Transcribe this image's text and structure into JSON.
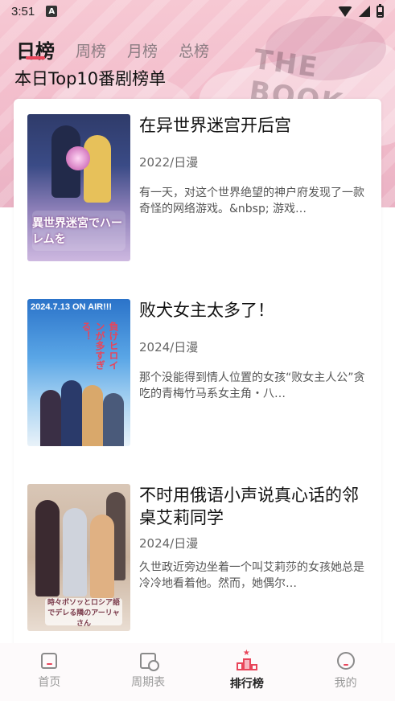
{
  "status_bar": {
    "time": "3:51",
    "notification_glyph": "A"
  },
  "tabs": [
    {
      "label": "日榜",
      "active": true
    },
    {
      "label": "周榜",
      "active": false
    },
    {
      "label": "月榜",
      "active": false
    },
    {
      "label": "总榜",
      "active": false
    }
  ],
  "section_title": "本日Top10番剧榜单",
  "rankings": [
    {
      "title": "在异世界迷宫开后宫",
      "meta": "2022/日漫",
      "description": "有一天，对这个世界绝望的神户府发现了一款奇怪的网络游戏。&nbsp; 游戏…",
      "cover_text": "異世界迷宮でハーレムを"
    },
    {
      "title": "败犬女主太多了！",
      "meta": "2024/日漫",
      "description": "那个没能得到情人位置的女孩“败女主人公”贪吃的青梅竹马系女主角・八…",
      "cover_date": "2024.7.13 ON AIR!!!",
      "cover_text": "負けヒロインが多すぎる！"
    },
    {
      "title": "不时用俄语小声说真心话的邻桌艾莉同学",
      "meta": "2024/日漫",
      "description": "久世政近旁边坐着一个叫艾莉莎的女孩她总是冷冷地看着他。然而，她偶尔…",
      "cover_text": "時々ボソッとロシア語でデレる隣のアーリャさん"
    }
  ],
  "bottom_nav": [
    {
      "label": "首页",
      "icon": "home-icon",
      "active": false
    },
    {
      "label": "周期表",
      "icon": "calendar-icon",
      "active": false
    },
    {
      "label": "排行榜",
      "icon": "ranking-icon",
      "active": true
    },
    {
      "label": "我的",
      "icon": "profile-icon",
      "active": false
    }
  ],
  "colors": {
    "accent": "#e8455a",
    "hero_background": "#f2bccb",
    "text_primary": "#111111",
    "text_secondary": "#666666"
  }
}
